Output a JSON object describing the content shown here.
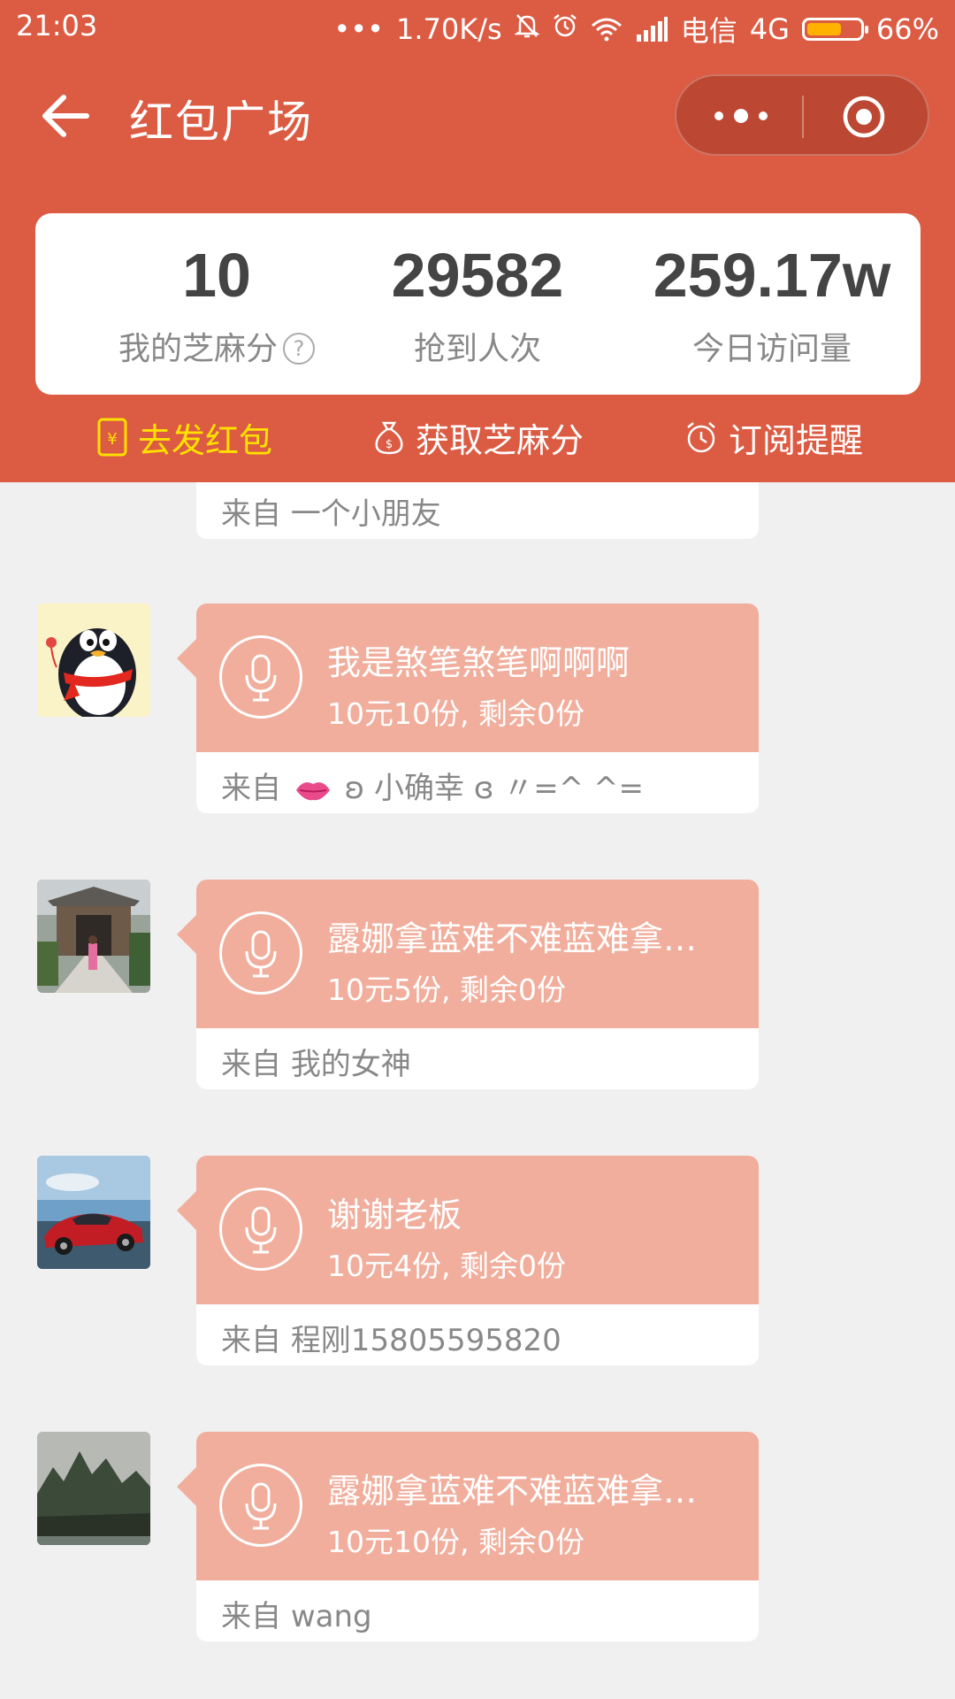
{
  "status_bar": {
    "time": "21:03",
    "dots": "•••",
    "net_speed": "1.70K/s",
    "carrier": "电信",
    "network": "4G",
    "battery_percent": "66%",
    "battery_level": 0.66,
    "icons": [
      "mute-bell-icon",
      "alarm-icon",
      "wifi-icon",
      "signal-icon",
      "battery-icon"
    ]
  },
  "nav": {
    "title": "红包广场",
    "back_icon": "arrow-left-icon",
    "capsule": [
      "more-icon",
      "target-icon"
    ]
  },
  "stats": [
    {
      "value": "10",
      "label": "我的芝麻分",
      "help_icon": "?"
    },
    {
      "value": "29582",
      "label": "抢到人次"
    },
    {
      "value": "259.17w",
      "label": "今日访问量"
    }
  ],
  "actions": [
    {
      "label": "去发红包",
      "icon": "red-envelope-icon",
      "color": "#ffe100"
    },
    {
      "label": "获取芝麻分",
      "icon": "money-bag-icon"
    },
    {
      "label": "订阅提醒",
      "icon": "alarm-clock-icon"
    }
  ],
  "list": {
    "partial_from": "来自 一个小朋友",
    "items": [
      {
        "avatar": "penguin-avatar",
        "title": "我是煞笔煞笔啊啊啊",
        "subtitle": "10元10份, 剩余0份",
        "from_prefix": "来自",
        "from": "ʚ 小确幸 ɞ 〃=^ ^=",
        "from_emoji": "lips-icon"
      },
      {
        "avatar": "courtyard-photo-avatar",
        "title": "露娜拿蓝难不难蓝难拿…",
        "subtitle": "10元5份, 剩余0份",
        "from_prefix": "来自",
        "from": "我的女神"
      },
      {
        "avatar": "red-car-photo-avatar",
        "title": "谢谢老板",
        "subtitle": "10元4份, 剩余0份",
        "from_prefix": "来自",
        "from": "程刚15805595820"
      },
      {
        "avatar": "mountain-photo-avatar",
        "title": "露娜拿蓝难不难蓝难拿…",
        "subtitle": "10元10份, 剩余0份",
        "from_prefix": "来自",
        "from": "wang"
      }
    ]
  },
  "colors": {
    "header_bg": "#dc5b43",
    "card_top": "#f1ae9d",
    "page_bg": "#f0f0f0"
  }
}
